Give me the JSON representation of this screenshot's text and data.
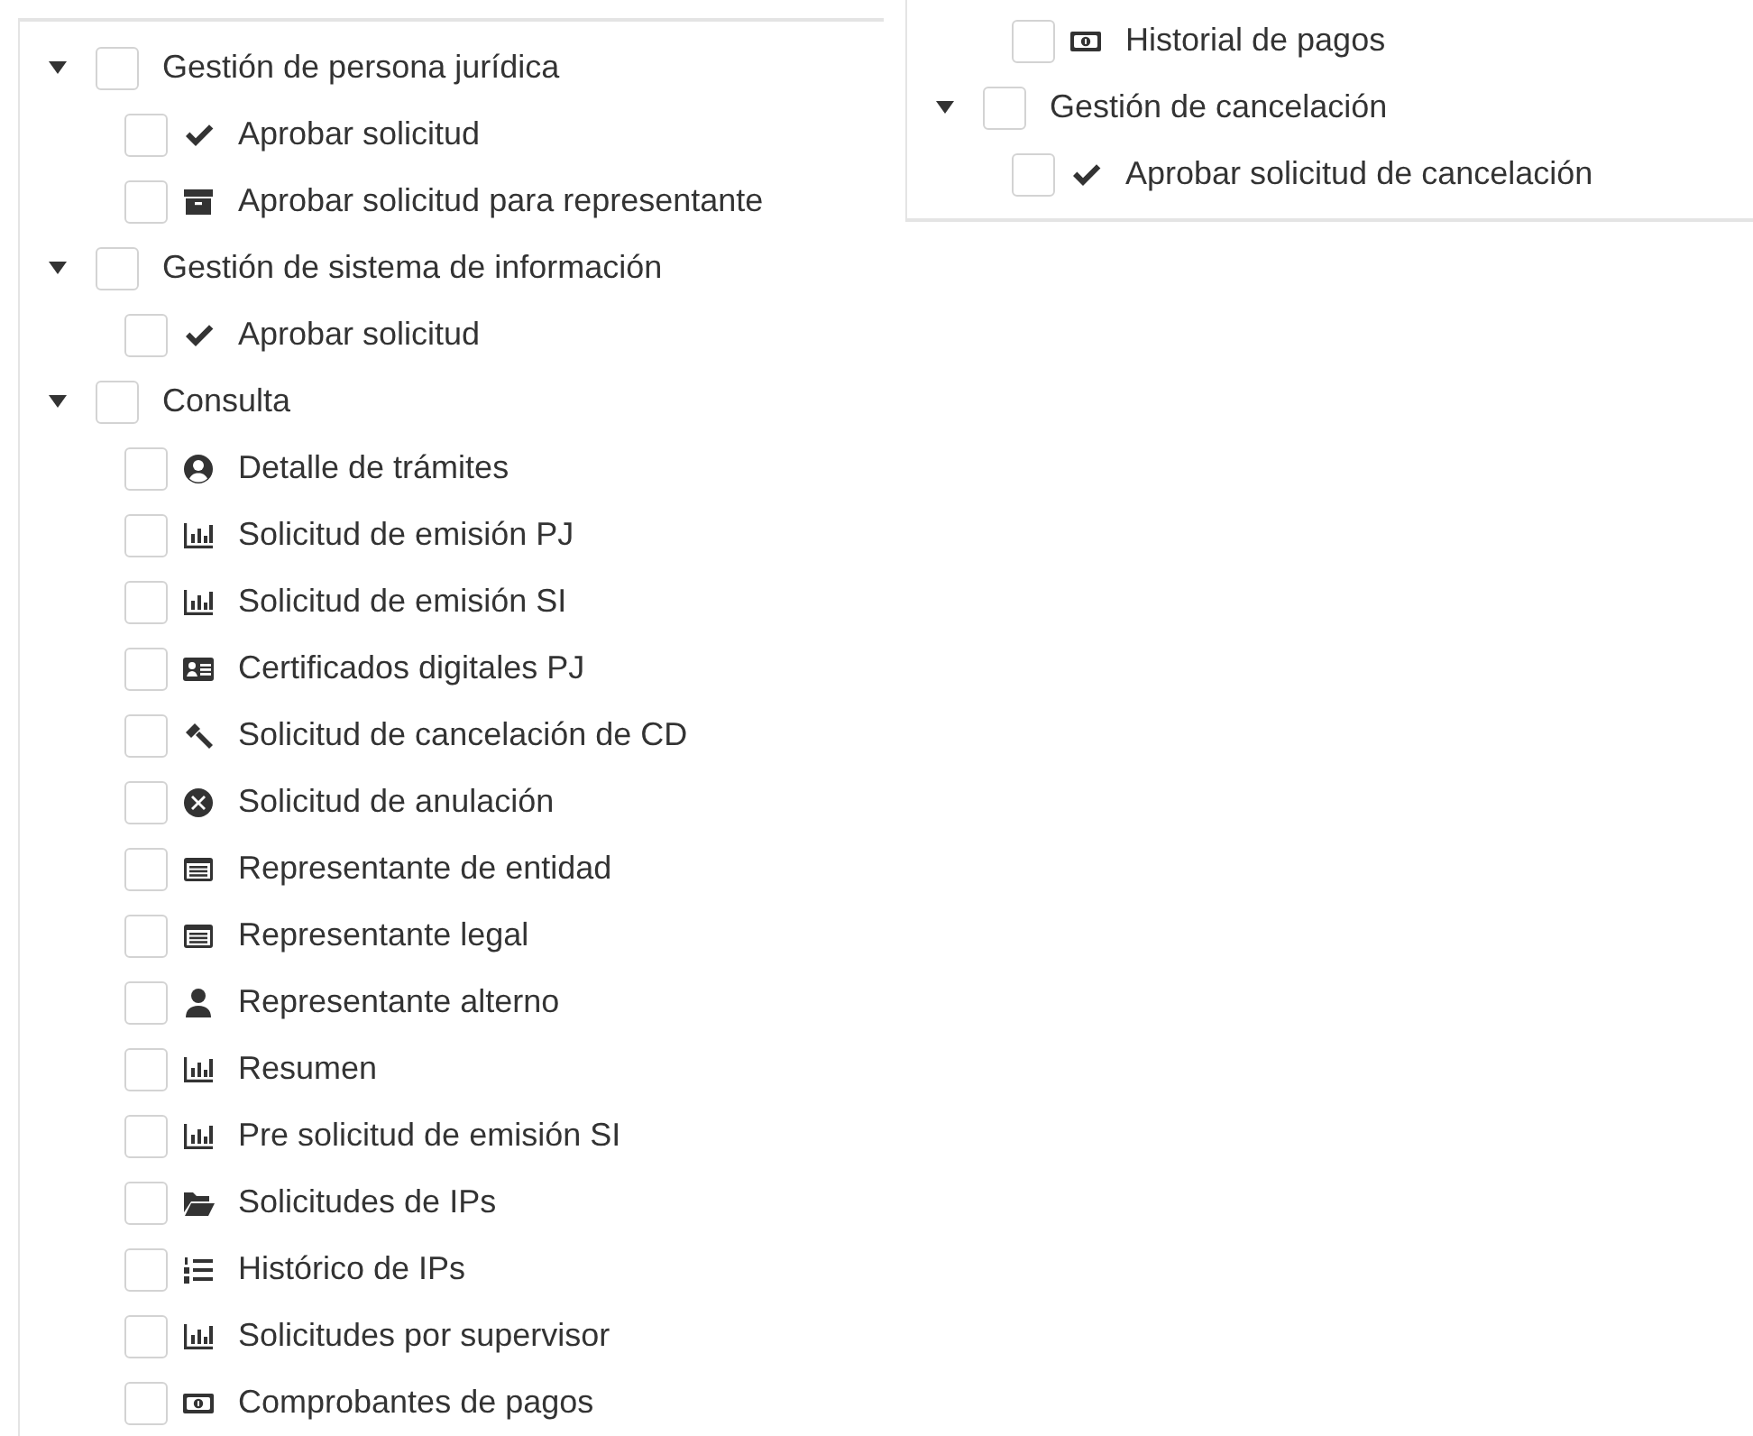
{
  "left_panel": {
    "nodes": [
      {
        "label": "Gestión de persona jurídica",
        "expanded": true,
        "checked": false,
        "children": [
          {
            "label": "Aprobar solicitud",
            "kind": "check",
            "checked": false
          },
          {
            "label": "Aprobar solicitud para representante",
            "kind": "archive",
            "checked": false
          }
        ]
      },
      {
        "label": "Gestión de sistema de información",
        "expanded": true,
        "checked": false,
        "children": [
          {
            "label": "Aprobar solicitud",
            "kind": "check",
            "checked": false
          }
        ]
      },
      {
        "label": "Consulta",
        "expanded": true,
        "checked": false,
        "children": [
          {
            "label": "Detalle de trámites",
            "kind": "usercircle",
            "checked": false
          },
          {
            "label": "Solicitud de emisión PJ",
            "kind": "chart",
            "checked": false
          },
          {
            "label": "Solicitud de emisión SI",
            "kind": "chart",
            "checked": false
          },
          {
            "label": "Certificados digitales PJ",
            "kind": "idcard",
            "checked": false
          },
          {
            "label": "Solicitud de cancelación de CD",
            "kind": "gavel",
            "checked": false
          },
          {
            "label": "Solicitud de anulación",
            "kind": "timescircle",
            "checked": false
          },
          {
            "label": "Representante de entidad",
            "kind": "window",
            "checked": false
          },
          {
            "label": "Representante legal",
            "kind": "window",
            "checked": false
          },
          {
            "label": "Representante alterno",
            "kind": "user",
            "checked": false
          },
          {
            "label": "Resumen",
            "kind": "chart",
            "checked": false
          },
          {
            "label": "Pre solicitud de emisión SI",
            "kind": "chart",
            "checked": false
          },
          {
            "label": "Solicitudes de IPs",
            "kind": "folder",
            "checked": false
          },
          {
            "label": "Histórico de IPs",
            "kind": "orderedlist",
            "checked": false
          },
          {
            "label": "Solicitudes por supervisor",
            "kind": "chart",
            "checked": false
          },
          {
            "label": "Comprobantes de pagos",
            "kind": "money",
            "checked": false
          }
        ]
      }
    ]
  },
  "right_panel": {
    "continued_children": [
      {
        "label": "Historial de pagos",
        "kind": "money",
        "checked": false
      }
    ],
    "nodes": [
      {
        "label": "Gestión de cancelación",
        "expanded": true,
        "checked": false,
        "children": [
          {
            "label": "Aprobar solicitud de cancelación",
            "kind": "check",
            "checked": false
          }
        ]
      }
    ]
  }
}
